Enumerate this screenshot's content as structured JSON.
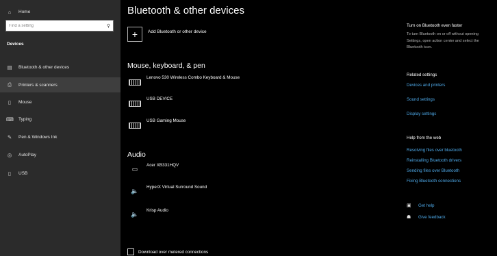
{
  "sidebar": {
    "home_label": "Home",
    "search_placeholder": "Find a setting",
    "section_title": "Devices",
    "items": [
      {
        "label": "Bluetooth & other devices"
      },
      {
        "label": "Printers & scanners"
      },
      {
        "label": "Mouse"
      },
      {
        "label": "Typing"
      },
      {
        "label": "Pen & Windows Ink"
      },
      {
        "label": "AutoPlay"
      },
      {
        "label": "USB"
      }
    ]
  },
  "main": {
    "title": "Bluetooth & other devices",
    "add_button_label": "Add Bluetooth or other device",
    "mouse_section_heading": "Mouse, keyboard, & pen",
    "input_devices": [
      {
        "name": "Lenovo 530 Wireless Combo Keyboard & Mouse",
        "icon": "keyboard-icon"
      },
      {
        "name": "USB DEVICE",
        "icon": "keyboard-icon"
      },
      {
        "name": "USB Gaming Mouse",
        "icon": "keyboard-icon"
      }
    ],
    "audio_section_heading": "Audio",
    "audio_devices": [
      {
        "name": "Acer XB331HQV",
        "icon": "monitor-icon"
      },
      {
        "name": "HyperX Virtual Surround Sound",
        "icon": "speaker-icon"
      },
      {
        "name": "Krisp Audio",
        "icon": "speaker-icon"
      }
    ],
    "metered_checkbox_label": "Download over metered connections"
  },
  "right": {
    "tip_title": "Turn on Bluetooth even faster",
    "tip_description": "To turn Bluetooth on or off without opening Settings, open action center and select the Bluetooth icon.",
    "related_title": "Related settings",
    "related_links": [
      "Devices and printers",
      "Sound settings",
      "Display settings"
    ],
    "help_title": "Help from the web",
    "help_links": [
      "Resolving files over bluetooth",
      "Reinstalling Bluetooth drivers",
      "Sending files over Bluetooth",
      "Fixing Bluetooth connections"
    ],
    "get_help_label": "Get help",
    "feedback_label": "Give feedback"
  },
  "colors": {
    "sidebar_bg": "#2b2b2b",
    "main_bg": "#000000",
    "link": "#4ea9e8",
    "active_item_bg": "#3e3e3e"
  }
}
